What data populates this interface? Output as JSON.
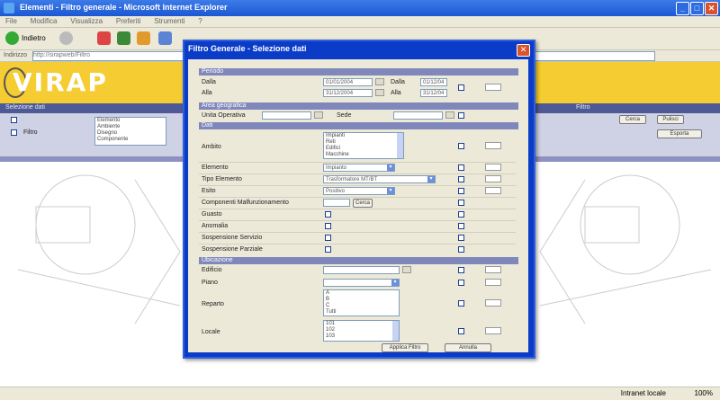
{
  "browser": {
    "window_title": "Elementi - Filtro generale - Microsoft Internet Explorer",
    "menu": [
      "File",
      "Modifica",
      "Visualizza",
      "Preferiti",
      "Strumenti",
      "?"
    ],
    "back_label": "Indietro",
    "address_label": "Indirizzo",
    "address_value": "http://sirapweb/Filtro",
    "status_zone": "Intranet locale",
    "zoom": "100%"
  },
  "page": {
    "logo_text": "VIRAP",
    "nav_left": "Selezione dati",
    "nav_right": "Filtro",
    "filter_label": "Filtro",
    "filter_list": [
      "Elemento",
      "Ambiente",
      "Disegno",
      "Componente"
    ],
    "right_buttons": [
      "Cerca",
      "Pulisci",
      "Esporta"
    ]
  },
  "modal": {
    "title": "Filtro Generale - Selezione dati",
    "close": "✕",
    "section_period": "Periodo",
    "row1_label": "Dalla",
    "row1_value": "01/01/2004",
    "row1_label2": "Dalla",
    "row1_value2": "01/12/04",
    "row2_label": "Alla",
    "row2_value": "31/12/2004",
    "row2_label2": "Alla",
    "row2_value2": "31/12/04",
    "section_area": "Area geografica",
    "area_label1": "Unita Operativa",
    "area_label2": "Sede",
    "section_data": "Dati",
    "label_ambito": "Ambito",
    "ambito_options": [
      "Impianti",
      "Reti",
      "Edifici",
      "Macchine"
    ],
    "label_elemento": "Elemento",
    "elemento_value": "Impianto",
    "label_tipo": "Tipo Elemento",
    "tipo_value": "Trasformatore MT/BT",
    "label_esito": "Esito",
    "esito_value": "Positivo",
    "label_componenti": "Componenti Malfunzionamento",
    "componenti_btn": "Cerca",
    "label_guasto": "Guasto",
    "label_anomalia": "Anomalia",
    "label_sospensione": "Sospensione Servizio",
    "label_sospensione2": "Sospensione Parziale",
    "section_location": "Ubicazione",
    "label_edificio": "Edificio",
    "label_piano": "Piano",
    "label_reparto": "Reparto",
    "reparto_options": [
      "A",
      "B",
      "C",
      "Tutti"
    ],
    "label_locale": "Locale",
    "locale_options": [
      "101",
      "102",
      "103"
    ],
    "btn_ok": "Applica Filtro",
    "btn_cancel": "Annulla"
  }
}
